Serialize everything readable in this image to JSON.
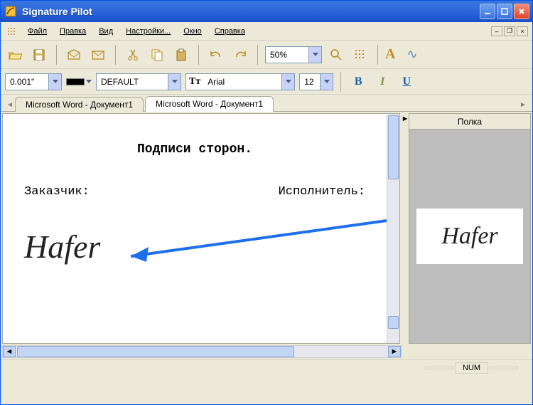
{
  "app": {
    "title": "Signature Pilot"
  },
  "menu": {
    "file": "Файл",
    "edit": "Правка",
    "view": "Вид",
    "settings": "Настройки...",
    "window": "Окно",
    "help": "Справка"
  },
  "toolbar1": {
    "zoom": "50%"
  },
  "toolbar2": {
    "units": "0.001\"",
    "style": "DEFAULT",
    "font_prefix": "Tт",
    "font": "Arial",
    "size": "12",
    "bold": "B",
    "italic": "I",
    "underline": "U",
    "letterA": "A",
    "wavy": "∿"
  },
  "tabs": {
    "tab1": "Microsoft Word - Документ1",
    "tab2": "Microsoft Word - Документ1"
  },
  "panel": {
    "title": "Полка"
  },
  "document": {
    "heading": "Подписи сторон.",
    "left_label": "Заказчик:",
    "right_label": "Исполнитель:",
    "signature_text": "Hafer",
    "thumb_signature": "Hafer"
  },
  "status": {
    "num": "NUM",
    "blank": " "
  }
}
